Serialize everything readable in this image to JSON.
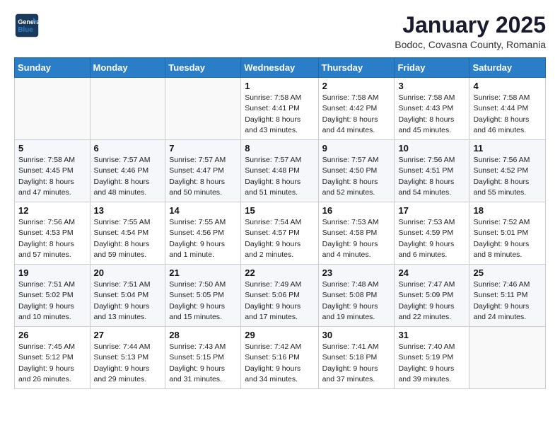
{
  "header": {
    "logo_line1": "General",
    "logo_line2": "Blue",
    "month_title": "January 2025",
    "subtitle": "Bodoc, Covasna County, Romania"
  },
  "weekdays": [
    "Sunday",
    "Monday",
    "Tuesday",
    "Wednesday",
    "Thursday",
    "Friday",
    "Saturday"
  ],
  "weeks": [
    [
      {
        "day": "",
        "sunrise": "",
        "sunset": "",
        "daylight": ""
      },
      {
        "day": "",
        "sunrise": "",
        "sunset": "",
        "daylight": ""
      },
      {
        "day": "",
        "sunrise": "",
        "sunset": "",
        "daylight": ""
      },
      {
        "day": "1",
        "sunrise": "Sunrise: 7:58 AM",
        "sunset": "Sunset: 4:41 PM",
        "daylight": "Daylight: 8 hours and 43 minutes."
      },
      {
        "day": "2",
        "sunrise": "Sunrise: 7:58 AM",
        "sunset": "Sunset: 4:42 PM",
        "daylight": "Daylight: 8 hours and 44 minutes."
      },
      {
        "day": "3",
        "sunrise": "Sunrise: 7:58 AM",
        "sunset": "Sunset: 4:43 PM",
        "daylight": "Daylight: 8 hours and 45 minutes."
      },
      {
        "day": "4",
        "sunrise": "Sunrise: 7:58 AM",
        "sunset": "Sunset: 4:44 PM",
        "daylight": "Daylight: 8 hours and 46 minutes."
      }
    ],
    [
      {
        "day": "5",
        "sunrise": "Sunrise: 7:58 AM",
        "sunset": "Sunset: 4:45 PM",
        "daylight": "Daylight: 8 hours and 47 minutes."
      },
      {
        "day": "6",
        "sunrise": "Sunrise: 7:57 AM",
        "sunset": "Sunset: 4:46 PM",
        "daylight": "Daylight: 8 hours and 48 minutes."
      },
      {
        "day": "7",
        "sunrise": "Sunrise: 7:57 AM",
        "sunset": "Sunset: 4:47 PM",
        "daylight": "Daylight: 8 hours and 50 minutes."
      },
      {
        "day": "8",
        "sunrise": "Sunrise: 7:57 AM",
        "sunset": "Sunset: 4:48 PM",
        "daylight": "Daylight: 8 hours and 51 minutes."
      },
      {
        "day": "9",
        "sunrise": "Sunrise: 7:57 AM",
        "sunset": "Sunset: 4:50 PM",
        "daylight": "Daylight: 8 hours and 52 minutes."
      },
      {
        "day": "10",
        "sunrise": "Sunrise: 7:56 AM",
        "sunset": "Sunset: 4:51 PM",
        "daylight": "Daylight: 8 hours and 54 minutes."
      },
      {
        "day": "11",
        "sunrise": "Sunrise: 7:56 AM",
        "sunset": "Sunset: 4:52 PM",
        "daylight": "Daylight: 8 hours and 55 minutes."
      }
    ],
    [
      {
        "day": "12",
        "sunrise": "Sunrise: 7:56 AM",
        "sunset": "Sunset: 4:53 PM",
        "daylight": "Daylight: 8 hours and 57 minutes."
      },
      {
        "day": "13",
        "sunrise": "Sunrise: 7:55 AM",
        "sunset": "Sunset: 4:54 PM",
        "daylight": "Daylight: 8 hours and 59 minutes."
      },
      {
        "day": "14",
        "sunrise": "Sunrise: 7:55 AM",
        "sunset": "Sunset: 4:56 PM",
        "daylight": "Daylight: 9 hours and 1 minute."
      },
      {
        "day": "15",
        "sunrise": "Sunrise: 7:54 AM",
        "sunset": "Sunset: 4:57 PM",
        "daylight": "Daylight: 9 hours and 2 minutes."
      },
      {
        "day": "16",
        "sunrise": "Sunrise: 7:53 AM",
        "sunset": "Sunset: 4:58 PM",
        "daylight": "Daylight: 9 hours and 4 minutes."
      },
      {
        "day": "17",
        "sunrise": "Sunrise: 7:53 AM",
        "sunset": "Sunset: 4:59 PM",
        "daylight": "Daylight: 9 hours and 6 minutes."
      },
      {
        "day": "18",
        "sunrise": "Sunrise: 7:52 AM",
        "sunset": "Sunset: 5:01 PM",
        "daylight": "Daylight: 9 hours and 8 minutes."
      }
    ],
    [
      {
        "day": "19",
        "sunrise": "Sunrise: 7:51 AM",
        "sunset": "Sunset: 5:02 PM",
        "daylight": "Daylight: 9 hours and 10 minutes."
      },
      {
        "day": "20",
        "sunrise": "Sunrise: 7:51 AM",
        "sunset": "Sunset: 5:04 PM",
        "daylight": "Daylight: 9 hours and 13 minutes."
      },
      {
        "day": "21",
        "sunrise": "Sunrise: 7:50 AM",
        "sunset": "Sunset: 5:05 PM",
        "daylight": "Daylight: 9 hours and 15 minutes."
      },
      {
        "day": "22",
        "sunrise": "Sunrise: 7:49 AM",
        "sunset": "Sunset: 5:06 PM",
        "daylight": "Daylight: 9 hours and 17 minutes."
      },
      {
        "day": "23",
        "sunrise": "Sunrise: 7:48 AM",
        "sunset": "Sunset: 5:08 PM",
        "daylight": "Daylight: 9 hours and 19 minutes."
      },
      {
        "day": "24",
        "sunrise": "Sunrise: 7:47 AM",
        "sunset": "Sunset: 5:09 PM",
        "daylight": "Daylight: 9 hours and 22 minutes."
      },
      {
        "day": "25",
        "sunrise": "Sunrise: 7:46 AM",
        "sunset": "Sunset: 5:11 PM",
        "daylight": "Daylight: 9 hours and 24 minutes."
      }
    ],
    [
      {
        "day": "26",
        "sunrise": "Sunrise: 7:45 AM",
        "sunset": "Sunset: 5:12 PM",
        "daylight": "Daylight: 9 hours and 26 minutes."
      },
      {
        "day": "27",
        "sunrise": "Sunrise: 7:44 AM",
        "sunset": "Sunset: 5:13 PM",
        "daylight": "Daylight: 9 hours and 29 minutes."
      },
      {
        "day": "28",
        "sunrise": "Sunrise: 7:43 AM",
        "sunset": "Sunset: 5:15 PM",
        "daylight": "Daylight: 9 hours and 31 minutes."
      },
      {
        "day": "29",
        "sunrise": "Sunrise: 7:42 AM",
        "sunset": "Sunset: 5:16 PM",
        "daylight": "Daylight: 9 hours and 34 minutes."
      },
      {
        "day": "30",
        "sunrise": "Sunrise: 7:41 AM",
        "sunset": "Sunset: 5:18 PM",
        "daylight": "Daylight: 9 hours and 37 minutes."
      },
      {
        "day": "31",
        "sunrise": "Sunrise: 7:40 AM",
        "sunset": "Sunset: 5:19 PM",
        "daylight": "Daylight: 9 hours and 39 minutes."
      },
      {
        "day": "",
        "sunrise": "",
        "sunset": "",
        "daylight": ""
      }
    ]
  ]
}
